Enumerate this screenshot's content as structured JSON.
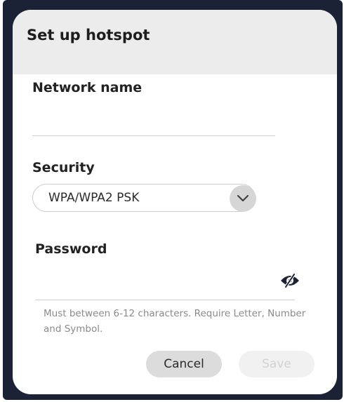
{
  "dialog": {
    "title": "Set up hotspot",
    "network_name": {
      "label": "Network name",
      "value": ""
    },
    "security": {
      "label": "Security",
      "selected": "WPA/WPA2 PSK"
    },
    "password": {
      "label": "Password",
      "value": "",
      "helper": "Must between 6-12 characters. Require Letter, Number and Symbol."
    },
    "buttons": {
      "cancel": "Cancel",
      "save": "Save"
    }
  },
  "colors": {
    "frame": "#1b2236",
    "header": "#ececec",
    "chevron_bg": "#d6d6d6",
    "icon": "#1a2233",
    "helper_text": "#8a8a8a",
    "save_disabled_text": "#d2d2d2"
  },
  "icons": {
    "dropdown": "chevron-down-icon",
    "password_toggle": "eye-slash-icon"
  }
}
